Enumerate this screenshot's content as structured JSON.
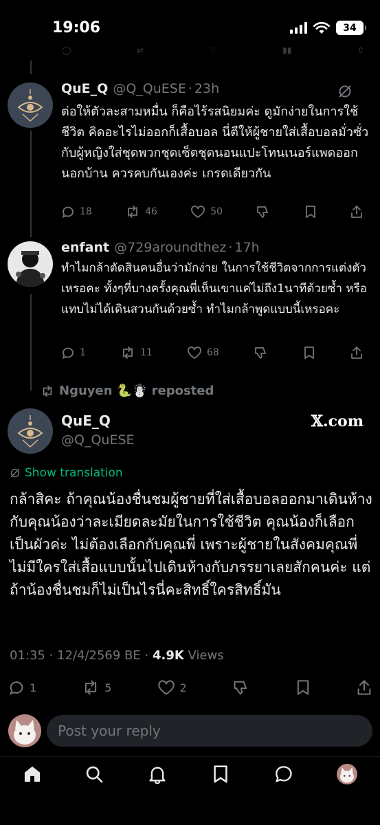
{
  "status_bar": {
    "time": "19:06",
    "battery": "34"
  },
  "tweets": [
    {
      "name": "QuE_Q",
      "handle": "@Q_QuESE",
      "time": "23h",
      "text": "ต่อให้ตัวละสามหมื่น ก็คือไร้รสนิยมค่ะ ดูมักง่ายในการใช้ชีวิต คิดอะไรไม่ออกก็เสื้อบอล นี่ตีให้ผู้ชายใส่เสื้อบอลมั่วซั่ว กับผู้หญิงใส่ชุดพวกชุดเซ็ตชุดนอนแปะโทนเนอร์แพดออกนอกบ้าน ควรคบกันเองค่ะ เกรดเดียวกัน",
      "replies": "18",
      "reposts": "46",
      "likes": "50"
    },
    {
      "name": "enfant",
      "handle": "@729aroundthez",
      "time": "17h",
      "text": "ทำไมกล้าตัดสินคนอื่นว่ามักง่าย ในการใช้ชีวิตจากการแต่งตัวเหรอคะ ทั้งๆที่บางครั้งคุณพี่เห็นเขาแค่ไม่ถึง1นาทีด้วยซ้ำ หรือแทบไม่ได้เดินสวนกันด้วยซ้ำ ทำไมกล้าพูดแบบนี้เหรอคะ",
      "replies": "1",
      "reposts": "11",
      "likes": "68"
    }
  ],
  "repost_note": {
    "user": "Nguyen 🐍☃️",
    "label": "reposted"
  },
  "main": {
    "name": "QuE_Q",
    "handle": "@Q_QuESE",
    "source": "𝕏.com",
    "show_translation": "Show translation",
    "text": "กล้าสิคะ ถ้าคุณน้องชื่นชมผู้ชายที่ใส่เสื้อบอลออกมาเดินห้างกับคุณน้องว่าละเมียดละมัยในการใช้ชีวิต คุณน้องก็เลือกเป็นผัวค่ะ ไม่ต้องเลือกกับคุณพี่ เพราะผู้ชายในสังคมคุณพี่ไม่มีใครใส่เสื้อแบบนั้นไปเดินห้างกับภรรยาเลยสักคนค่ะ แต่ถ้าน้องชื่นชมก็ไม่เป็นไรนี่คะสิทธิ์ใครสิทธิ์มัน",
    "timestamp": "01:35 · 12/4/2569 BE ·",
    "views_count": "4.9K",
    "views_label": "Views",
    "replies": "1",
    "reposts": "5",
    "likes": "2"
  },
  "reply_bar": {
    "placeholder": "Post your reply"
  },
  "icons": [
    "home-icon",
    "search-icon",
    "notifications-icon",
    "bookmarks-icon",
    "messages-icon"
  ],
  "colors": {
    "background": "#000000",
    "text": "#e7e9ea",
    "muted": "#71767b",
    "translation": "#00ba7c"
  }
}
